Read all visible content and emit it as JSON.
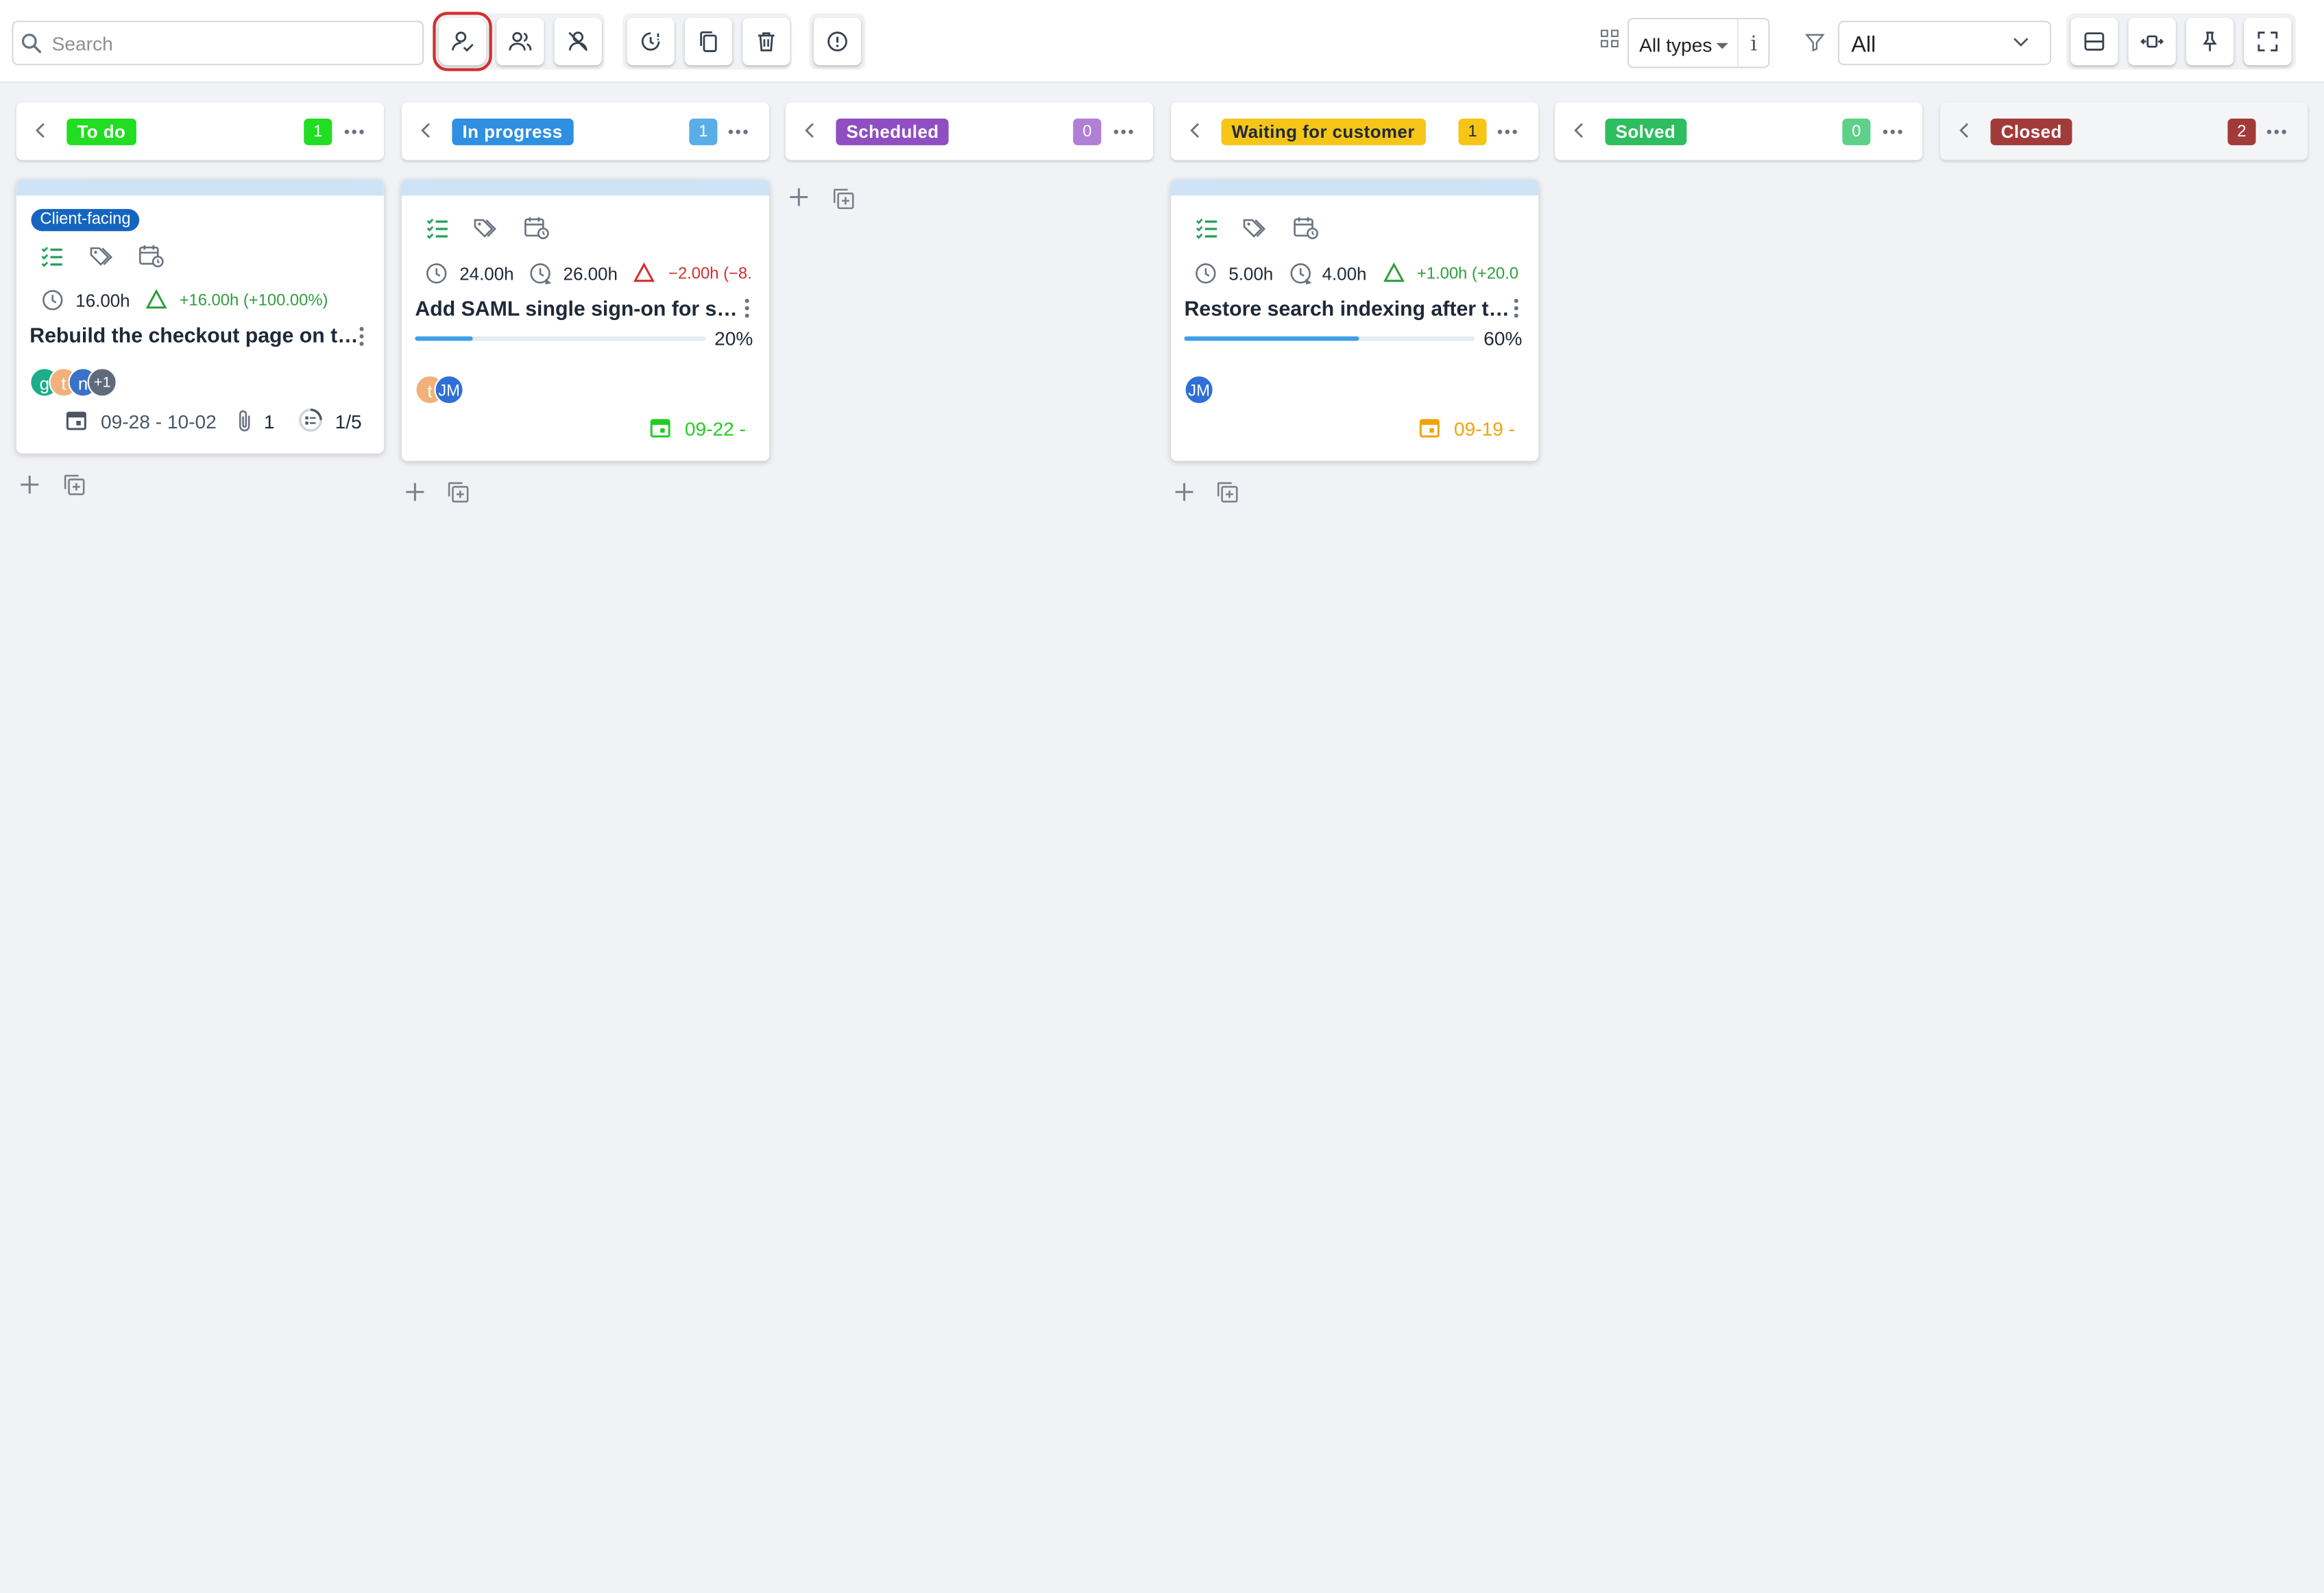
{
  "toolbar": {
    "search_placeholder": "Search",
    "type_select": "All types",
    "type_info": "i",
    "filter_select": "All"
  },
  "columns": [
    {
      "label": "To do",
      "count": "1",
      "color": "#22dd22",
      "count_color": "#22dd22"
    },
    {
      "label": "In progress",
      "count": "1",
      "color": "#2f8fe0",
      "count_color": "#5aaee8"
    },
    {
      "label": "Scheduled",
      "count": "0",
      "color": "#8f4fc2",
      "count_color": "#b07fd6"
    },
    {
      "label": "Waiting for customer",
      "count": "1",
      "color": "#f5c518",
      "count_color": "#f5c518"
    },
    {
      "label": "Solved",
      "count": "0",
      "color": "#2ebd5f",
      "count_color": "#5fd08a"
    },
    {
      "label": "Closed",
      "count": "2",
      "color": "#a33a3a",
      "count_color": "#a33a3a"
    }
  ],
  "cards": {
    "todo": {
      "tag": "Client-facing",
      "estimate": "16.00h",
      "delta": "+16.00h (+100.00%)",
      "title": "Rebuild the checkout page on th...",
      "avatars": [
        "g",
        "t",
        "n",
        "+1"
      ],
      "dates": "09-28 - 10-02",
      "attachments": "1",
      "checklist": "1/5"
    },
    "inprogress": {
      "estimate": "24.00h",
      "spent": "26.00h",
      "delta": "−2.00h (−8.",
      "title": "Add SAML single sign-on for staf...",
      "progress_pct": 20,
      "progress_label": "20%",
      "avatars": [
        "t",
        "JM"
      ],
      "date": "09-22 -"
    },
    "waiting": {
      "estimate": "5.00h",
      "spent": "4.00h",
      "delta": "+1.00h (+20.0",
      "title": "Restore search indexing after th...",
      "progress_pct": 60,
      "progress_label": "60%",
      "avatars": [
        "JM"
      ],
      "date": "09-19 -"
    }
  }
}
